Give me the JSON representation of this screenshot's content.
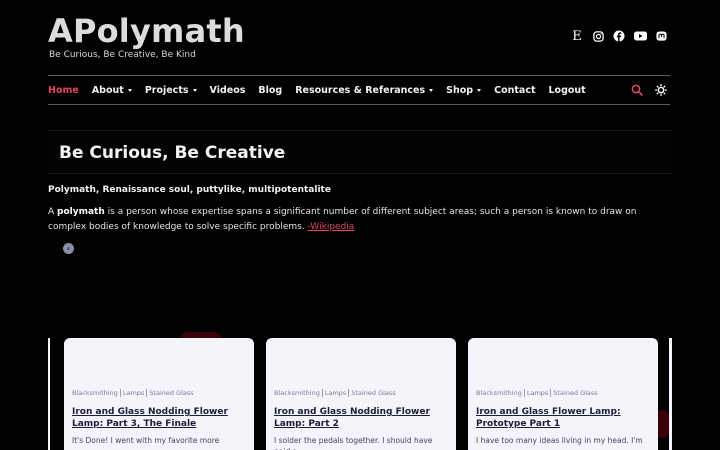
{
  "site": {
    "title": "APolymath",
    "tagline": "Be Curious, Be Creative, Be Kind"
  },
  "social": [
    {
      "name": "etsy-icon",
      "glyph": "E"
    },
    {
      "name": "instagram-icon",
      "glyph": "◎"
    },
    {
      "name": "facebook-icon",
      "glyph": "●"
    },
    {
      "name": "youtube-icon",
      "glyph": "▶"
    },
    {
      "name": "mastodon-icon",
      "glyph": "◉"
    }
  ],
  "nav": {
    "items": [
      {
        "label": "Home",
        "active": true,
        "dropdown": false
      },
      {
        "label": "About",
        "active": false,
        "dropdown": true
      },
      {
        "label": "Projects",
        "active": false,
        "dropdown": true
      },
      {
        "label": "Videos",
        "active": false,
        "dropdown": false
      },
      {
        "label": "Blog",
        "active": false,
        "dropdown": false
      },
      {
        "label": "Resources & Referances",
        "active": false,
        "dropdown": true
      },
      {
        "label": "Shop",
        "active": false,
        "dropdown": true
      },
      {
        "label": "Contact",
        "active": false,
        "dropdown": false
      },
      {
        "label": "Logout",
        "active": false,
        "dropdown": false
      }
    ],
    "search_icon": "search-icon",
    "theme_icon": "sun-icon"
  },
  "colors": {
    "accent": "#e0455e",
    "background": "#000000",
    "card": "#f4f4fa"
  },
  "hero": {
    "title": "Be Curious, Be Creative"
  },
  "intro": {
    "subtitle": "Polymath, Renaissance soul, puttylike, multipotentalite",
    "prefix": "A ",
    "bold": "polymath",
    "body": " is a person whose expertise spans a significant number of different subject areas; such a person is known to draw on complex bodies of knowledge to solve specific problems. ",
    "link": "-Wikipedia"
  },
  "carousel": {
    "prev_icon": "chevron-left-icon",
    "cards": [
      {
        "categories": [
          "Blacksmithing",
          "Lamps",
          "Stained Glass"
        ],
        "title": "Iron and Glass Nodding Flower Lamp: Part 3, The Finale",
        "excerpt": "It's Done! I went with my favorite more"
      },
      {
        "categories": [
          "Blacksmithing",
          "Lamps",
          "Stained Glass"
        ],
        "title": "Iron and Glass Nodding Flower Lamp: Part 2",
        "excerpt": "I solder the pedals together. I should have paid a"
      },
      {
        "categories": [
          "Blacksmithing",
          "Lamps",
          "Stained Glass"
        ],
        "title": "Iron and Glass Flower Lamp: Prototype Part 1",
        "excerpt": "I have too many ideas living in my head. I'm"
      }
    ]
  }
}
